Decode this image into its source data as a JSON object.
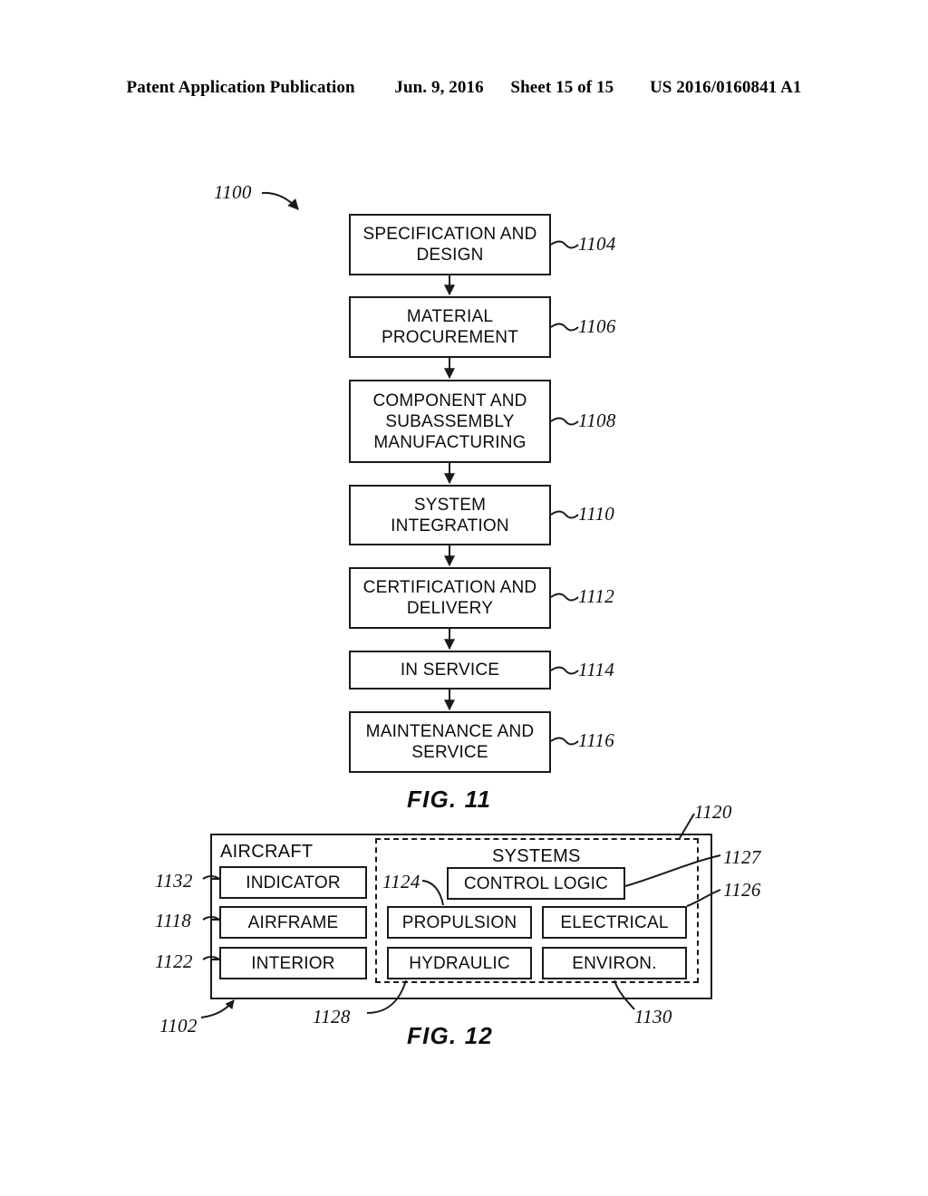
{
  "header": {
    "publication": "Patent Application Publication",
    "date": "Jun. 9, 2016",
    "sheet": "Sheet 15 of 15",
    "patent_number": "US 2016/0160841 A1"
  },
  "fig11": {
    "caption": "FIG. 11",
    "diagram_ref": "1100",
    "steps": [
      {
        "label": "SPECIFICATION AND DESIGN",
        "ref": "1104"
      },
      {
        "label": "MATERIAL PROCUREMENT",
        "ref": "1106"
      },
      {
        "label": "COMPONENT AND SUBASSEMBLY MANUFACTURING",
        "ref": "1108"
      },
      {
        "label": "SYSTEM INTEGRATION",
        "ref": "1110"
      },
      {
        "label": "CERTIFICATION AND DELIVERY",
        "ref": "1112"
      },
      {
        "label": "IN SERVICE",
        "ref": "1114"
      },
      {
        "label": "MAINTENANCE AND SERVICE",
        "ref": "1116"
      }
    ]
  },
  "fig12": {
    "caption": "FIG. 12",
    "aircraft_label": "AIRCRAFT",
    "systems_label": "SYSTEMS",
    "aircraft_ref": "1102",
    "systems_ref": "1120",
    "aircraft_items": [
      {
        "label": "INDICATOR",
        "ref": "1132"
      },
      {
        "label": "AIRFRAME",
        "ref": "1118"
      },
      {
        "label": "INTERIOR",
        "ref": "1122"
      }
    ],
    "systems_items": [
      {
        "label": "CONTROL LOGIC",
        "ref": "1127"
      },
      {
        "label": "PROPULSION",
        "ref": "1124"
      },
      {
        "label": "ELECTRICAL",
        "ref": "1126"
      },
      {
        "label": "HYDRAULIC",
        "ref": "1128"
      },
      {
        "label": "ENVIRON.",
        "ref": "1130"
      }
    ]
  }
}
